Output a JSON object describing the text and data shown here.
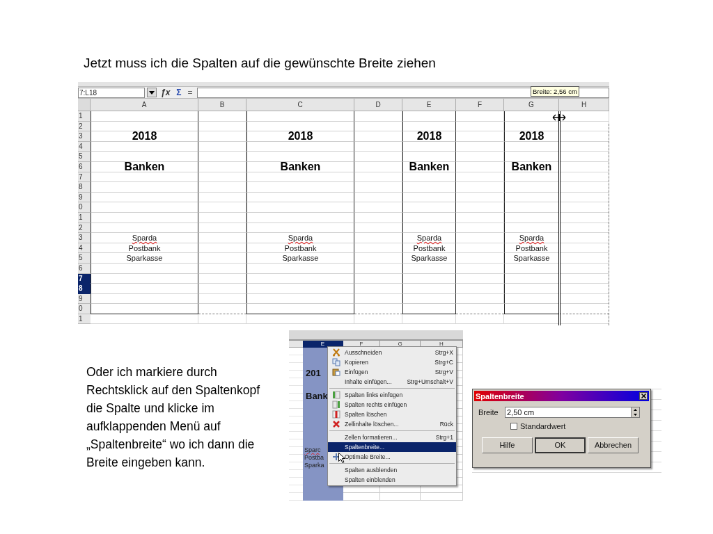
{
  "heading": "Jetzt muss ich die Spalten auf die gewünschte Breite ziehen",
  "sheet": {
    "name_box": "7:L18",
    "formula_buttons": [
      "ƒx",
      "Σ",
      "="
    ],
    "tooltip": "Breite: 2,56 cm",
    "columns": [
      "A",
      "B",
      "C",
      "D",
      "E",
      "F",
      "G",
      "H"
    ],
    "rows": [
      {
        "label": "1",
        "selected": false
      },
      {
        "label": "2",
        "selected": false
      },
      {
        "label": "3",
        "selected": false
      },
      {
        "label": "4",
        "selected": false
      },
      {
        "label": "5",
        "selected": false
      },
      {
        "label": "6",
        "selected": false
      },
      {
        "label": "7",
        "selected": false
      },
      {
        "label": "8",
        "selected": false
      },
      {
        "label": "9",
        "selected": false
      },
      {
        "label": "0",
        "selected": false
      },
      {
        "label": "1",
        "selected": false
      },
      {
        "label": "2",
        "selected": false
      },
      {
        "label": "3",
        "selected": false
      },
      {
        "label": "4",
        "selected": false
      },
      {
        "label": "5",
        "selected": false
      },
      {
        "label": "6",
        "selected": false
      },
      {
        "label": "7",
        "selected": true
      },
      {
        "label": "8",
        "selected": true
      },
      {
        "label": "9",
        "selected": false
      },
      {
        "label": "0",
        "selected": false
      },
      {
        "label": "1",
        "selected": false
      }
    ],
    "blocks": [
      {
        "year": "2018",
        "title": "Banken",
        "items": [
          {
            "text": "Sparda",
            "spellcheck_error": true
          },
          {
            "text": "Postbank",
            "spellcheck_error": false
          },
          {
            "text": "Sparkasse",
            "spellcheck_error": false
          }
        ]
      },
      {
        "year": "2018",
        "title": "Banken",
        "items": [
          {
            "text": "Sparda",
            "spellcheck_error": true
          },
          {
            "text": "Postbank",
            "spellcheck_error": false
          },
          {
            "text": "Sparkasse",
            "spellcheck_error": false
          }
        ]
      },
      {
        "year": "2018",
        "title": "Banken",
        "items": [
          {
            "text": "Sparda",
            "spellcheck_error": true
          },
          {
            "text": "Postbank",
            "spellcheck_error": false
          },
          {
            "text": "Sparkasse",
            "spellcheck_error": false
          }
        ]
      },
      {
        "year": "2018",
        "title": "Banken",
        "items": [
          {
            "text": "Sparda",
            "spellcheck_error": true
          },
          {
            "text": "Postbank",
            "spellcheck_error": false
          },
          {
            "text": "Sparkasse",
            "spellcheck_error": false
          }
        ]
      }
    ]
  },
  "explanation": "Oder ich markiere durch\nRechtsklick auf den Spaltenkopf\ndie Spalte und klicke im\naufklappenden Menü auf\n„Spaltenbreite“ wo ich dann die\nBreite eingeben kann.",
  "menu_sheet": {
    "columns": [
      {
        "label": "E",
        "selected": true
      },
      {
        "label": "F",
        "selected": false
      },
      {
        "label": "G",
        "selected": false
      },
      {
        "label": "H",
        "selected": false
      }
    ],
    "column_texts": [
      {
        "text": "201",
        "kind": "bold",
        "spellcheck_error": false
      },
      {
        "text": "Bank",
        "kind": "bold",
        "spellcheck_error": false
      },
      {
        "text": "Sparc",
        "kind": "plain",
        "spellcheck_error": true
      },
      {
        "text": "Postba",
        "kind": "plain",
        "spellcheck_error": false
      },
      {
        "text": "Sparka",
        "kind": "plain",
        "spellcheck_error": false
      }
    ]
  },
  "context_menu": {
    "items": [
      {
        "kind": "item",
        "label": "Ausschneiden",
        "shortcut": "Strg+X",
        "selected": false
      },
      {
        "kind": "item",
        "label": "Kopieren",
        "shortcut": "Strg+C",
        "selected": false
      },
      {
        "kind": "item",
        "label": "Einfügen",
        "shortcut": "Strg+V",
        "selected": false
      },
      {
        "kind": "item",
        "label": "Inhalte einfügen...",
        "shortcut": "Strg+Umschalt+V",
        "selected": false
      },
      {
        "kind": "separator"
      },
      {
        "kind": "item",
        "label": "Spalten links einfügen",
        "selected": false
      },
      {
        "kind": "item",
        "label": "Spalten rechts einfügen",
        "selected": false
      },
      {
        "kind": "item",
        "label": "Spalten löschen",
        "selected": false
      },
      {
        "kind": "item",
        "label": "Zellinhalte löschen...",
        "shortcut": "Rück",
        "selected": false
      },
      {
        "kind": "separator"
      },
      {
        "kind": "item",
        "label": "Zellen formatieren...",
        "shortcut": "Strg+1",
        "selected": false
      },
      {
        "kind": "item",
        "label": "Spaltenbreite...",
        "selected": true
      },
      {
        "kind": "item",
        "label": "Optimale Breite...",
        "selected": false
      },
      {
        "kind": "separator"
      },
      {
        "kind": "item",
        "label": "Spalten ausblenden",
        "selected": false
      },
      {
        "kind": "item",
        "label": "Spalten einblenden",
        "selected": false
      }
    ]
  },
  "dialog": {
    "title": "Spaltenbreite",
    "field_label": "Breite",
    "field_value": "2,50 cm",
    "checkbox": {
      "label": "Standardwert",
      "checked": false
    },
    "buttons": [
      {
        "label": "Hilfe",
        "default": false
      },
      {
        "label": "OK",
        "default": true
      },
      {
        "label": "Abbrechen",
        "default": false
      }
    ]
  }
}
